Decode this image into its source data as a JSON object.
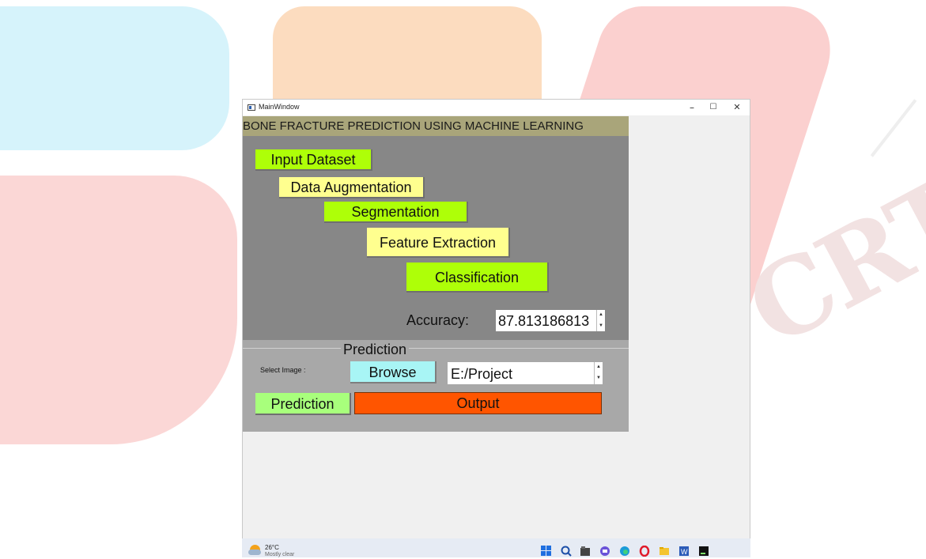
{
  "window": {
    "title": "MainWindow",
    "minimize_glyph": "–",
    "maximize_glyph": "☐",
    "close_glyph": "✕"
  },
  "app": {
    "header": "BONE FRACTURE PREDICTION USING MACHINE LEARNING",
    "pipeline": {
      "input_dataset": "Input Dataset",
      "data_augmentation": "Data Augmentation",
      "segmentation": "Segmentation",
      "feature_extraction": "Feature Extraction",
      "classification": "Classification"
    },
    "accuracy": {
      "label": "Accuracy:",
      "value": "87.813186813"
    },
    "prediction_group": {
      "title": "Prediction",
      "select_label": "Select  Image :",
      "browse_label": "Browse",
      "path_value": "E:/Project",
      "predict_label": "Prediction",
      "output_label": "Output"
    }
  },
  "colors": {
    "green_button": "#aeff08",
    "yellow_button": "#ffff8f",
    "browse_button": "#a8f5f5",
    "prediction_button": "#a8ff7c",
    "output": "#ff5500",
    "header": "#a9a57a"
  },
  "taskbar": {
    "temperature": "26°C",
    "condition": "Mostly clear",
    "icons": [
      "windows-start-icon",
      "search-icon",
      "file-explorer-icon",
      "chat-icon",
      "edge-icon",
      "opera-icon",
      "folder-icon",
      "word-icon",
      "pycharm-icon"
    ]
  },
  "watermark": {
    "text": "CRT"
  }
}
